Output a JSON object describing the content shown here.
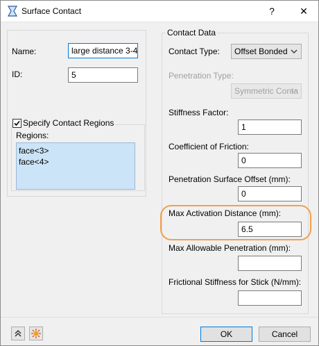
{
  "window": {
    "title": "Surface Contact",
    "help_label": "?",
    "close_label": "✕"
  },
  "left": {
    "name_label": "Name:",
    "name_value": "large distance 3-4",
    "id_label": "ID:",
    "id_value": "5",
    "specify_label": "Specify Contact Regions",
    "specify_checked": true,
    "regions_label": "Regions:",
    "regions": [
      "face<3>",
      "face<4>"
    ]
  },
  "contact": {
    "group_title": "Contact Data",
    "contact_type_label": "Contact Type:",
    "contact_type_value": "Offset Bonded",
    "penetration_type_label": "Penetration Type:",
    "penetration_type_value": "Symmetric Conta",
    "stiffness_label": "Stiffness Factor:",
    "stiffness_value": "1",
    "friction_label": "Coefficient of Friction:",
    "friction_value": "0",
    "offset_label": "Penetration Surface Offset (mm):",
    "offset_value": "0",
    "max_activation_label": "Max Activation Distance (mm):",
    "max_activation_value": "6.5",
    "max_penetration_label": "Max Allowable Penetration (mm):",
    "max_penetration_value": "",
    "frictional_stiffness_label": "Frictional Stiffness for Stick (N/mm):",
    "frictional_stiffness_value": ""
  },
  "footer": {
    "ok_label": "OK",
    "cancel_label": "Cancel"
  },
  "colors": {
    "accent": "#0078d7",
    "highlight": "#f0a050",
    "list_bg": "#cce4f7"
  }
}
